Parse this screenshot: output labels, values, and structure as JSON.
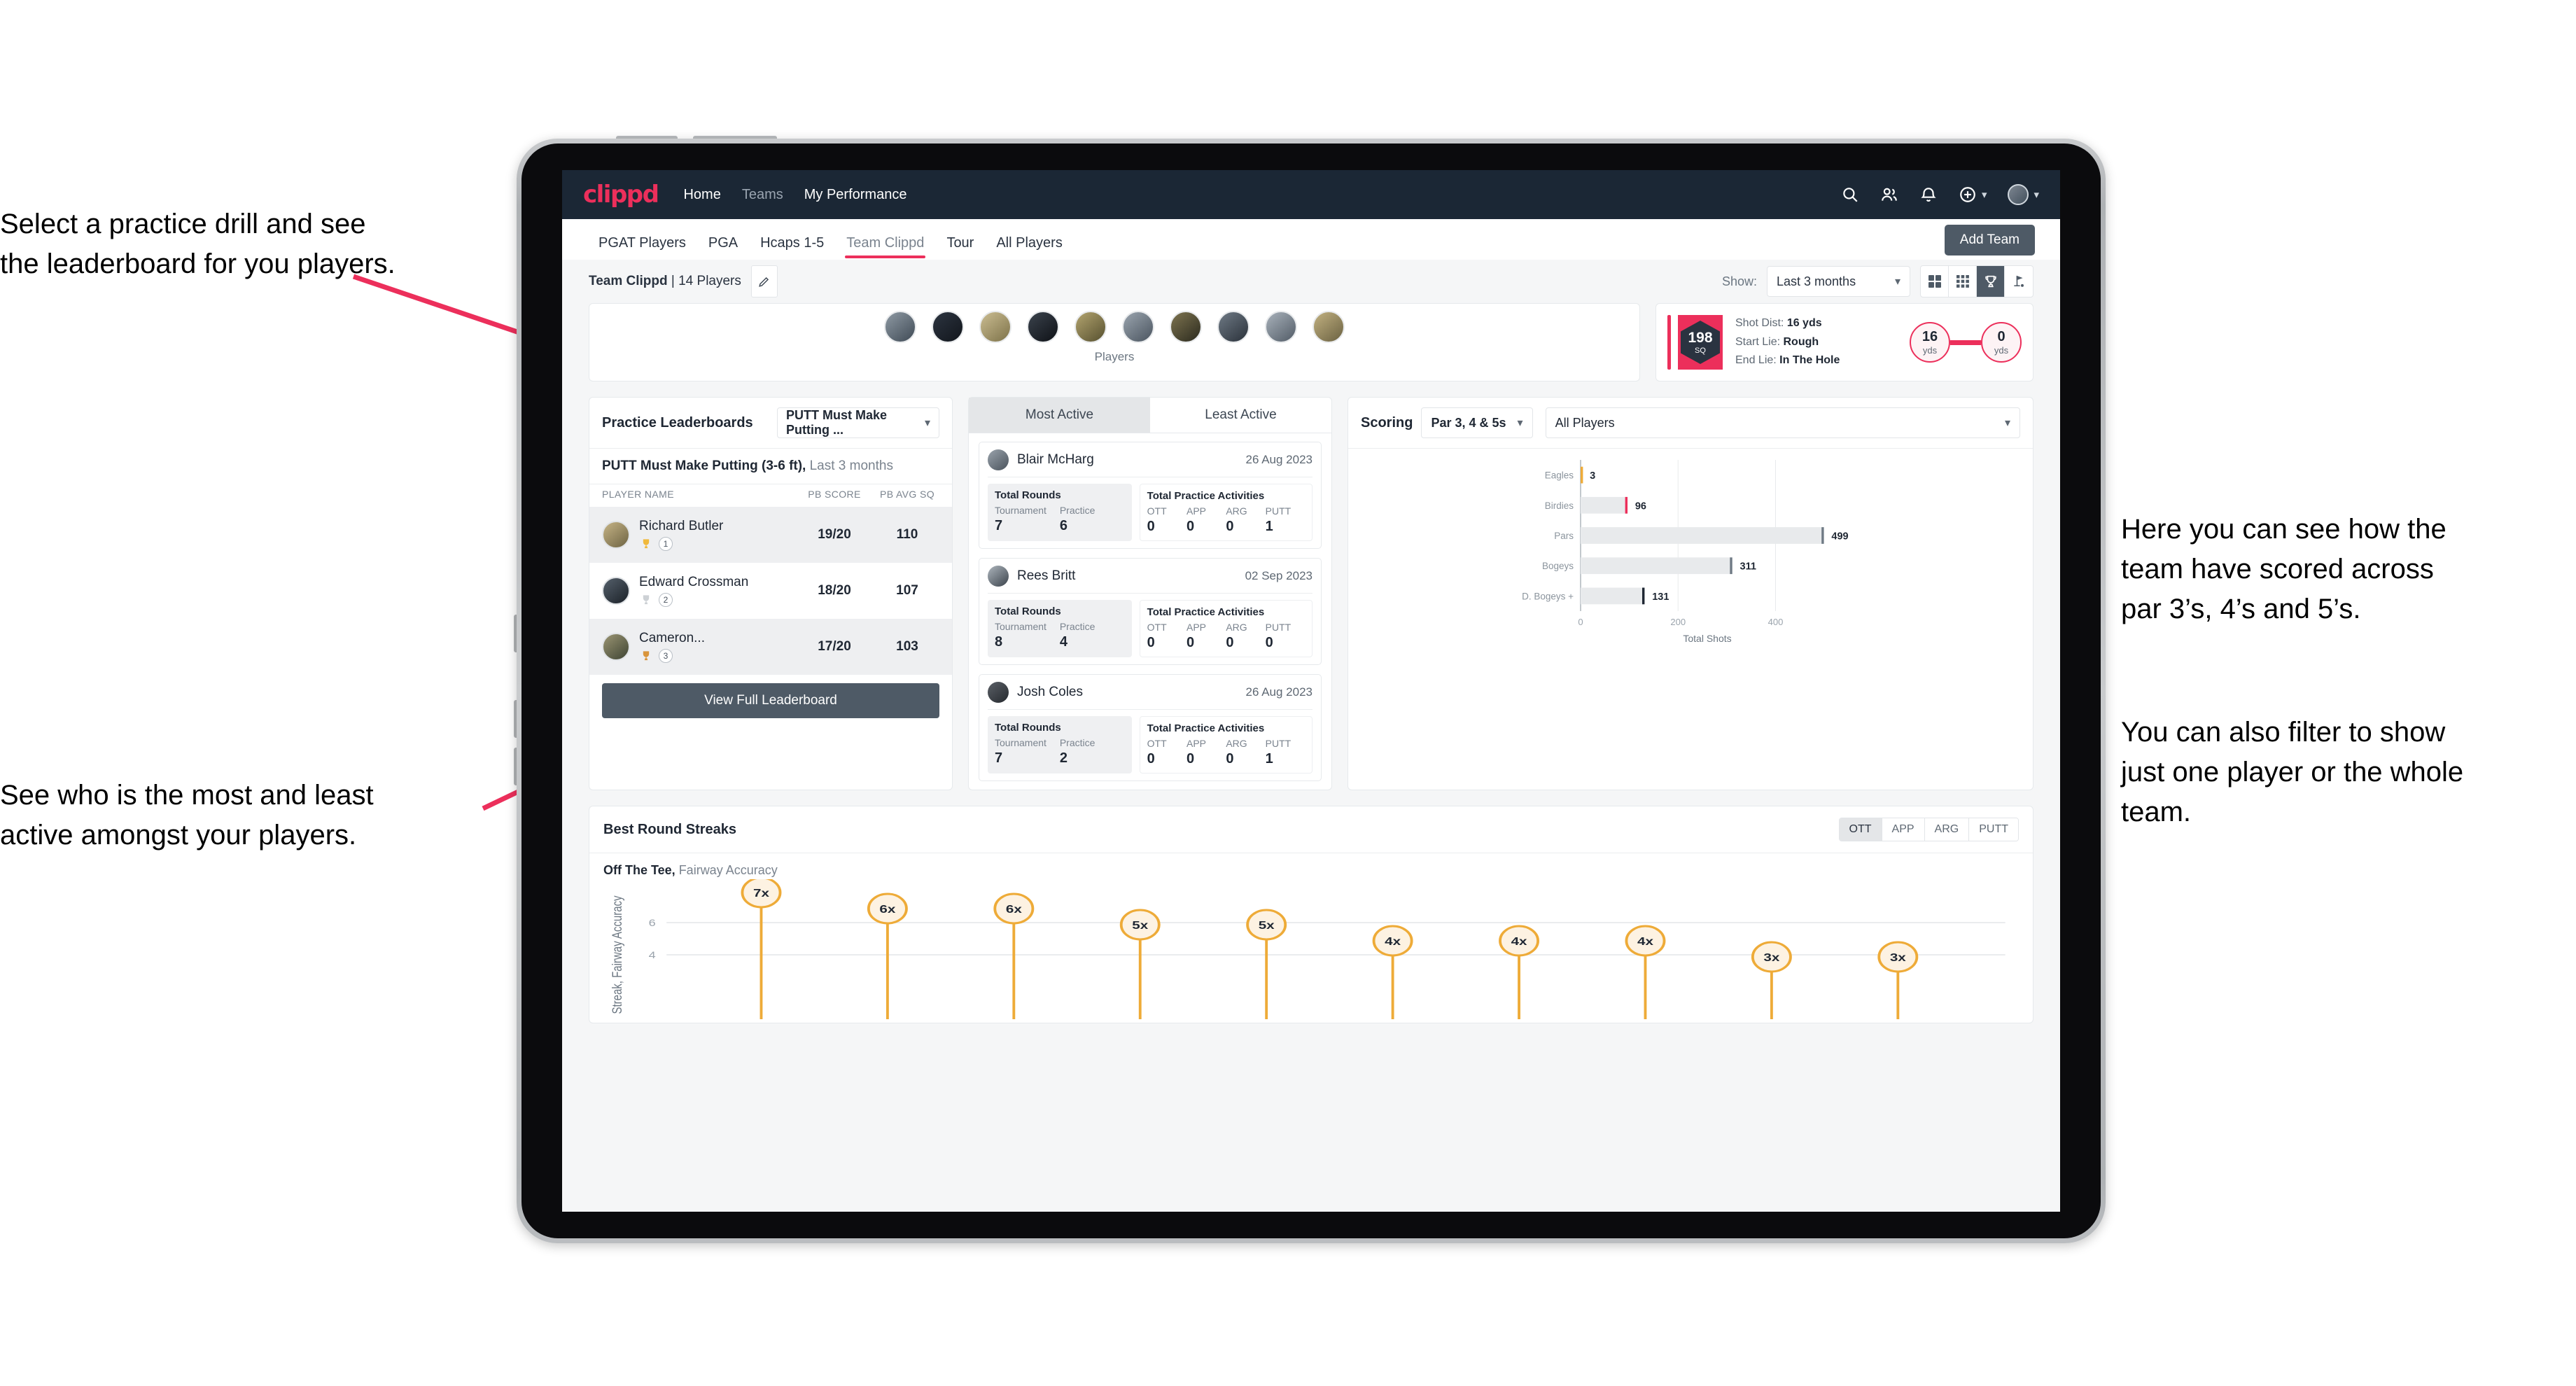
{
  "annotations": {
    "left_top": "Select a practice drill and see\nthe leaderboard for you players.",
    "left_bottom": "See who is the most and least\nactive amongst your players.",
    "right_top": "Here you can see how the\nteam have scored across\npar 3’s, 4’s and 5’s.",
    "right_bottom": "You can also filter to show\njust one player or the whole\nteam."
  },
  "colors": {
    "brand_pink": "#ec2f5b",
    "navy": "#1b2735",
    "slate": "#4e5a66",
    "amber": "#eeab38"
  },
  "topnav": {
    "logo": "clippd",
    "links": [
      {
        "label": "Home",
        "active": true
      },
      {
        "label": "Teams",
        "active": false
      },
      {
        "label": "My Performance",
        "active": true
      }
    ],
    "icons": [
      "search-icon",
      "people-icon",
      "bell-icon",
      "plus-circle-icon",
      "avatar"
    ]
  },
  "tabs": {
    "items": [
      {
        "label": "PGAT Players",
        "active": false
      },
      {
        "label": "PGA",
        "active": false
      },
      {
        "label": "Hcaps 1-5",
        "active": false
      },
      {
        "label": "Team Clippd",
        "active": true
      },
      {
        "label": "Tour",
        "active": false
      },
      {
        "label": "All Players",
        "active": false
      }
    ],
    "add_team_label": "Add Team"
  },
  "subheader": {
    "team_name": "Team Clippd",
    "player_count": "| 14 Players",
    "show_label": "Show:",
    "show_value": "Last 3 months",
    "view_toggles": [
      "grid-4-icon",
      "grid-9-icon",
      "trophy-icon",
      "golf-flag-icon"
    ],
    "active_toggle_index": 2
  },
  "players_card": {
    "caption": "Players",
    "avatar_count": 10
  },
  "shot_card": {
    "sq_value": "198",
    "sq_unit": "SQ",
    "shot_dist_label": "Shot Dist:",
    "shot_dist_value": "16 yds",
    "start_lie_label": "Start Lie:",
    "start_lie_value": "Rough",
    "end_lie_label": "End Lie:",
    "end_lie_value": "In The Hole",
    "from_value": "16",
    "from_unit": "yds",
    "to_value": "0",
    "to_unit": "yds"
  },
  "leaderboard": {
    "title": "Practice Leaderboards",
    "drill_select": "PUTT Must Make Putting ...",
    "subtitle_bold": "PUTT Must Make Putting (3-6 ft),",
    "subtitle_light": " Last 3 months",
    "columns": [
      "PLAYER NAME",
      "PB SCORE",
      "PB AVG SQ"
    ],
    "rows": [
      {
        "name": "Richard Butler",
        "rank": "1",
        "trophy": "gold",
        "pb_score": "19/20",
        "pb_avg_sq": "110"
      },
      {
        "name": "Edward Crossman",
        "rank": "2",
        "trophy": "silver",
        "pb_score": "18/20",
        "pb_avg_sq": "107"
      },
      {
        "name": "Cameron...",
        "rank": "3",
        "trophy": "bronze",
        "pb_score": "17/20",
        "pb_avg_sq": "103"
      }
    ],
    "button_label": "View Full Leaderboard"
  },
  "activity": {
    "tabs": [
      {
        "label": "Most Active",
        "active": true
      },
      {
        "label": "Least Active",
        "active": false
      }
    ],
    "rounds_heading": "Total Rounds",
    "practice_heading": "Total Practice Activities",
    "rounds_keys": [
      "Tournament",
      "Practice"
    ],
    "practice_keys": [
      "OTT",
      "APP",
      "ARG",
      "PUTT"
    ],
    "players": [
      {
        "name": "Blair McHarg",
        "date": "26 Aug 2023",
        "rounds": [
          "7",
          "6"
        ],
        "practice": [
          "0",
          "0",
          "0",
          "1"
        ]
      },
      {
        "name": "Rees Britt",
        "date": "02 Sep 2023",
        "rounds": [
          "8",
          "4"
        ],
        "practice": [
          "0",
          "0",
          "0",
          "0"
        ]
      },
      {
        "name": "Josh Coles",
        "date": "26 Aug 2023",
        "rounds": [
          "7",
          "2"
        ],
        "practice": [
          "0",
          "0",
          "0",
          "1"
        ]
      }
    ]
  },
  "scoring": {
    "title": "Scoring",
    "par_select": "Par 3, 4 & 5s",
    "player_select": "All Players"
  },
  "streaks": {
    "title": "Best Round Streaks",
    "toggles": [
      {
        "label": "OTT",
        "active": true
      },
      {
        "label": "APP",
        "active": false
      },
      {
        "label": "ARG",
        "active": false
      },
      {
        "label": "PUTT",
        "active": false
      }
    ],
    "subtitle_bold": "Off The Tee,",
    "subtitle_light": " Fairway Accuracy"
  },
  "chart_data": [
    {
      "type": "bar",
      "orientation": "horizontal",
      "title": "Scoring",
      "categories": [
        "Eagles",
        "Birdies",
        "Pars",
        "Bogeys",
        "D. Bogeys +"
      ],
      "values": [
        3,
        96,
        499,
        311,
        131
      ],
      "value_labels": [
        "3",
        "96",
        "499",
        "311",
        "131"
      ],
      "cap_colors": [
        "#eeab38",
        "#ec2f5b",
        "#6f7a85",
        "#6f7a85",
        "#1f2733"
      ],
      "bar_color": "#e8eaec",
      "xlabel": "Total Shots",
      "ylabel": "",
      "xlim": [
        0,
        520
      ],
      "xticks": [
        0,
        200,
        400
      ],
      "xticklabels": [
        "0",
        "200",
        "400"
      ],
      "grid": true,
      "legend": "none"
    },
    {
      "type": "scatter",
      "title": "Off The Tee, Fairway Accuracy",
      "ylabel": "Streak, Fairway Accuracy",
      "xlabel": "",
      "values": [
        7,
        6,
        6,
        5,
        5,
        4,
        4,
        4,
        3,
        3
      ],
      "point_labels": [
        "7x",
        "6x",
        "6x",
        "5x",
        "5x",
        "4x",
        "4x",
        "4x",
        "3x",
        "3x"
      ],
      "yticks": [
        4,
        6
      ],
      "yticklabels": [
        "4",
        "6"
      ],
      "ylim": [
        0,
        8
      ],
      "marker_color": "#eeab38",
      "marker_fill": "#fdf2e2",
      "grid": true,
      "legend": "none"
    }
  ]
}
